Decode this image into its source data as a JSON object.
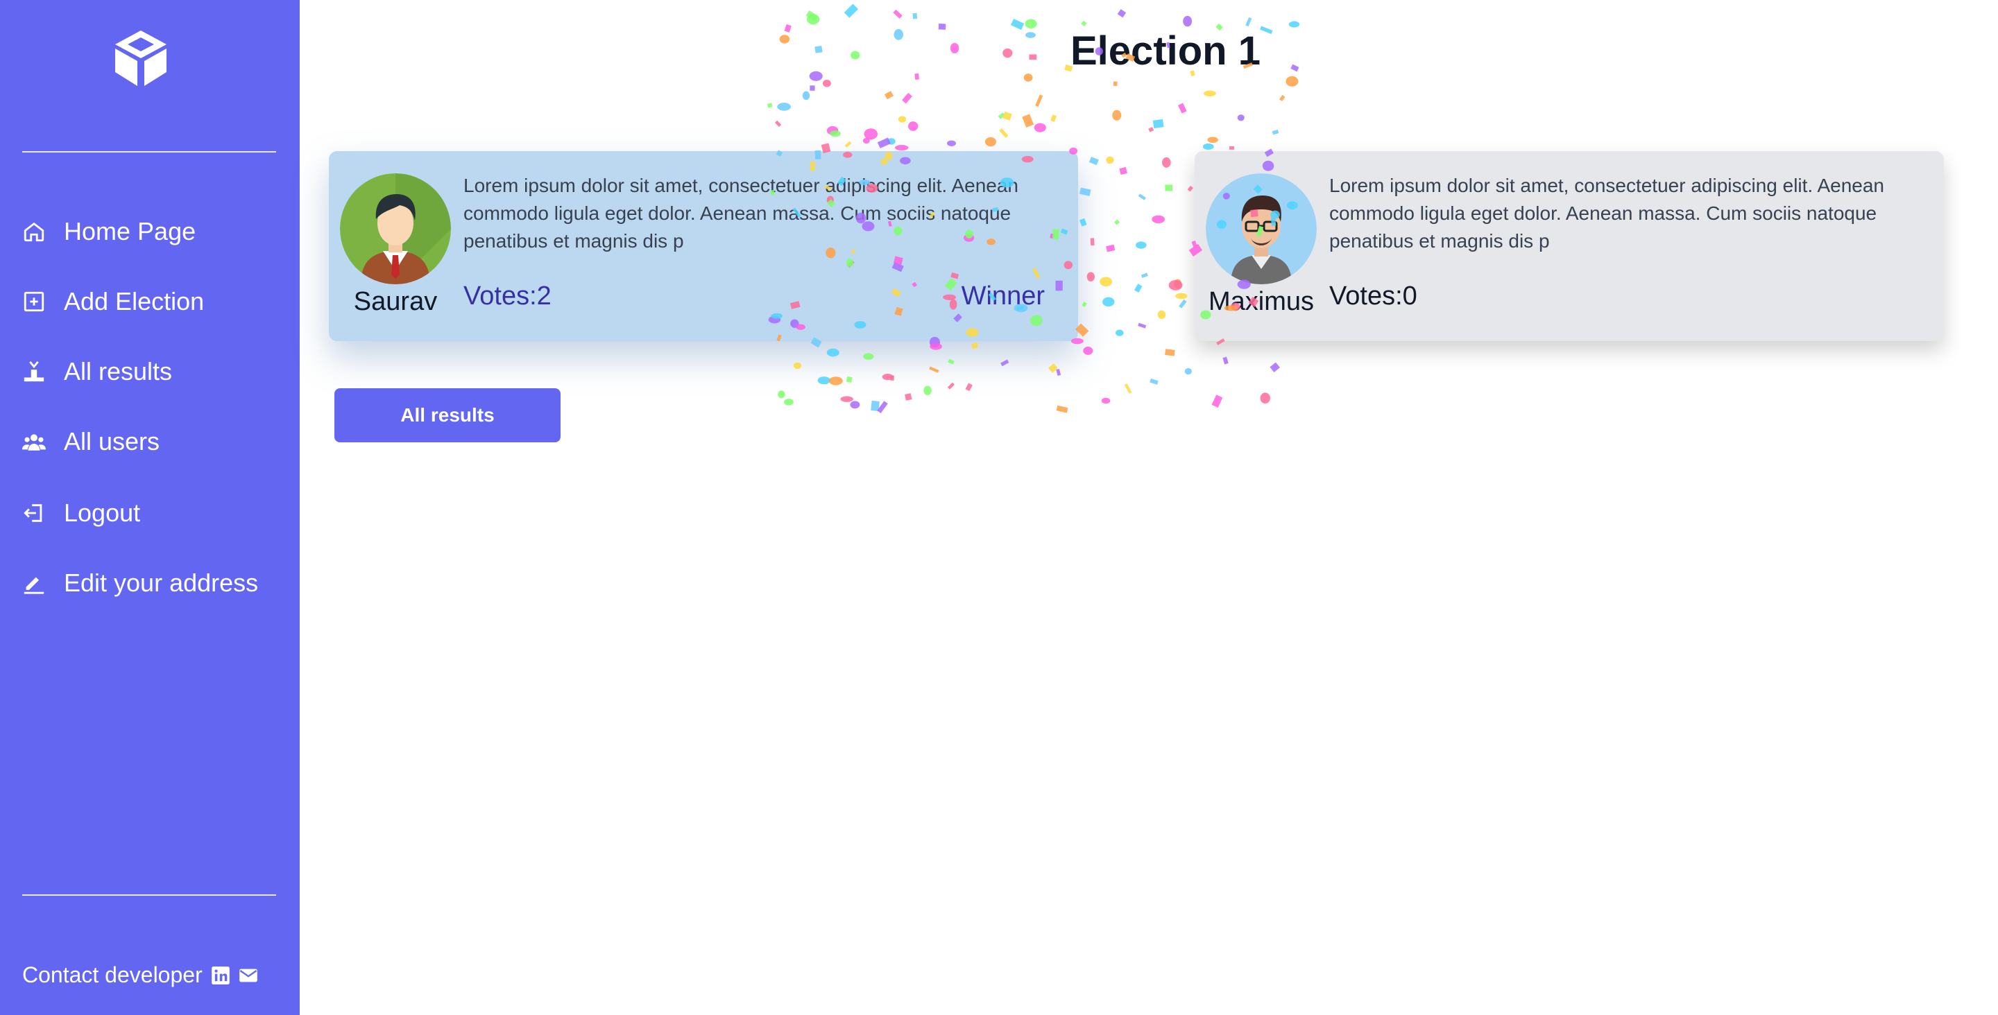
{
  "sidebar": {
    "logo_icon": "cube-logo-icon",
    "items": [
      {
        "label": "Home Page",
        "icon": "home-icon"
      },
      {
        "label": "Add Election",
        "icon": "plus-square-icon"
      },
      {
        "label": "All results",
        "icon": "podium-icon"
      },
      {
        "label": "All users",
        "icon": "users-icon"
      },
      {
        "label": "Logout",
        "icon": "logout-icon"
      },
      {
        "label": "Edit your address",
        "icon": "pen-icon"
      }
    ],
    "contact_label": "Contact developer",
    "contact_icons": [
      "linkedin-icon",
      "mail-icon"
    ]
  },
  "main": {
    "title": "Election 1",
    "candidates": [
      {
        "name": "Saurav",
        "description": "Lorem ipsum dolor sit amet, consectetuer adipiscing elit. Aenean commodo ligula eget dolor. Aenean massa. Cum sociis natoque penatibus et magnis dis p",
        "votes_text": "Votes:2",
        "status": "Winner"
      },
      {
        "name": "Maximus",
        "description": "Lorem ipsum dolor sit amet, consectetuer adipiscing elit. Aenean commodo ligula eget dolor. Aenean massa. Cum sociis natoque penatibus et magnis dis p",
        "votes_text": "Votes:0"
      }
    ],
    "all_results_button": "All results"
  },
  "colors": {
    "sidebar_bg": "#6366f1",
    "winner_card_bg": "#bcd8f0",
    "card_bg": "#e5e7eb",
    "winner_text": "#3730a3",
    "button_bg": "#6366f1"
  }
}
